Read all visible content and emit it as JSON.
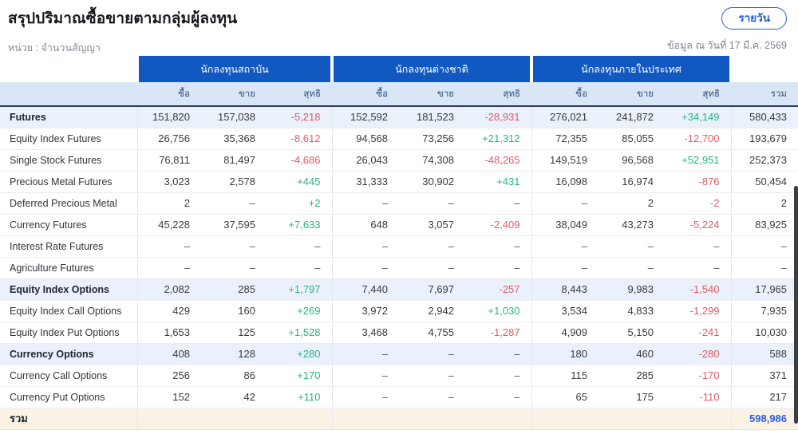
{
  "page": {
    "title": "สรุปปริมาณซื้อขายตามกลุ่มผู้ลงทุน",
    "unit_label": "หน่วย : จำนวนสัญญา",
    "daily_button": "รายวัน",
    "as_of": "ข้อมูล ณ วันที่ 17 มี.ค. 2569"
  },
  "table": {
    "groups": [
      "นักลงทุนสถาบัน",
      "นักลงทุนต่างชาติ",
      "นักลงทุนภายในประเทศ"
    ],
    "subheaders": {
      "buy": "ซื้อ",
      "sell": "ขาย",
      "net": "สุทธิ"
    },
    "total_header": "รวม",
    "rows": [
      {
        "label": "Futures",
        "section": true,
        "values": [
          "151,820",
          "157,038",
          "-5,218",
          "152,592",
          "181,523",
          "-28,931",
          "276,021",
          "241,872",
          "+34,149",
          "580,433"
        ]
      },
      {
        "label": "Equity Index Futures",
        "section": false,
        "values": [
          "26,756",
          "35,368",
          "-8,612",
          "94,568",
          "73,256",
          "+21,312",
          "72,355",
          "85,055",
          "-12,700",
          "193,679"
        ]
      },
      {
        "label": "Single Stock Futures",
        "section": false,
        "values": [
          "76,811",
          "81,497",
          "-4,686",
          "26,043",
          "74,308",
          "-48,265",
          "149,519",
          "96,568",
          "+52,951",
          "252,373"
        ]
      },
      {
        "label": "Precious Metal Futures",
        "section": false,
        "values": [
          "3,023",
          "2,578",
          "+445",
          "31,333",
          "30,902",
          "+431",
          "16,098",
          "16,974",
          "-876",
          "50,454"
        ]
      },
      {
        "label": "Deferred Precious Metal",
        "section": false,
        "values": [
          "2",
          "–",
          "+2",
          "–",
          "–",
          "–",
          "–",
          "2",
          "-2",
          "2"
        ]
      },
      {
        "label": "Currency Futures",
        "section": false,
        "values": [
          "45,228",
          "37,595",
          "+7,633",
          "648",
          "3,057",
          "-2,409",
          "38,049",
          "43,273",
          "-5,224",
          "83,925"
        ]
      },
      {
        "label": "Interest Rate Futures",
        "section": false,
        "values": [
          "–",
          "–",
          "–",
          "–",
          "–",
          "–",
          "–",
          "–",
          "–",
          "–"
        ]
      },
      {
        "label": "Agriculture Futures",
        "section": false,
        "values": [
          "–",
          "–",
          "–",
          "–",
          "–",
          "–",
          "–",
          "–",
          "–",
          "–"
        ]
      },
      {
        "label": "Equity Index Options",
        "section": true,
        "values": [
          "2,082",
          "285",
          "+1,797",
          "7,440",
          "7,697",
          "-257",
          "8,443",
          "9,983",
          "-1,540",
          "17,965"
        ]
      },
      {
        "label": "Equity Index Call Options",
        "section": false,
        "values": [
          "429",
          "160",
          "+269",
          "3,972",
          "2,942",
          "+1,030",
          "3,534",
          "4,833",
          "-1,299",
          "7,935"
        ]
      },
      {
        "label": "Equity Index Put Options",
        "section": false,
        "values": [
          "1,653",
          "125",
          "+1,528",
          "3,468",
          "4,755",
          "-1,287",
          "4,909",
          "5,150",
          "-241",
          "10,030"
        ]
      },
      {
        "label": "Currency Options",
        "section": true,
        "values": [
          "408",
          "128",
          "+280",
          "–",
          "–",
          "–",
          "180",
          "460",
          "-280",
          "588"
        ]
      },
      {
        "label": "Currency Call Options",
        "section": false,
        "values": [
          "256",
          "86",
          "+170",
          "–",
          "–",
          "–",
          "115",
          "285",
          "-170",
          "371"
        ]
      },
      {
        "label": "Currency Put Options",
        "section": false,
        "values": [
          "152",
          "42",
          "+110",
          "–",
          "–",
          "–",
          "65",
          "175",
          "-110",
          "217"
        ]
      }
    ],
    "total_row": {
      "label": "รวม",
      "value": "598,986"
    }
  },
  "colors": {
    "accent_blue": "#1159c1",
    "positive_green": "#27b583",
    "negative_red": "#e25a6a",
    "total_value_blue": "#2b5fd3",
    "section_row_bg": "#eaf1fa",
    "subheader_bg": "#d9e6f6",
    "total_row_bg": "#fbf2e6"
  }
}
